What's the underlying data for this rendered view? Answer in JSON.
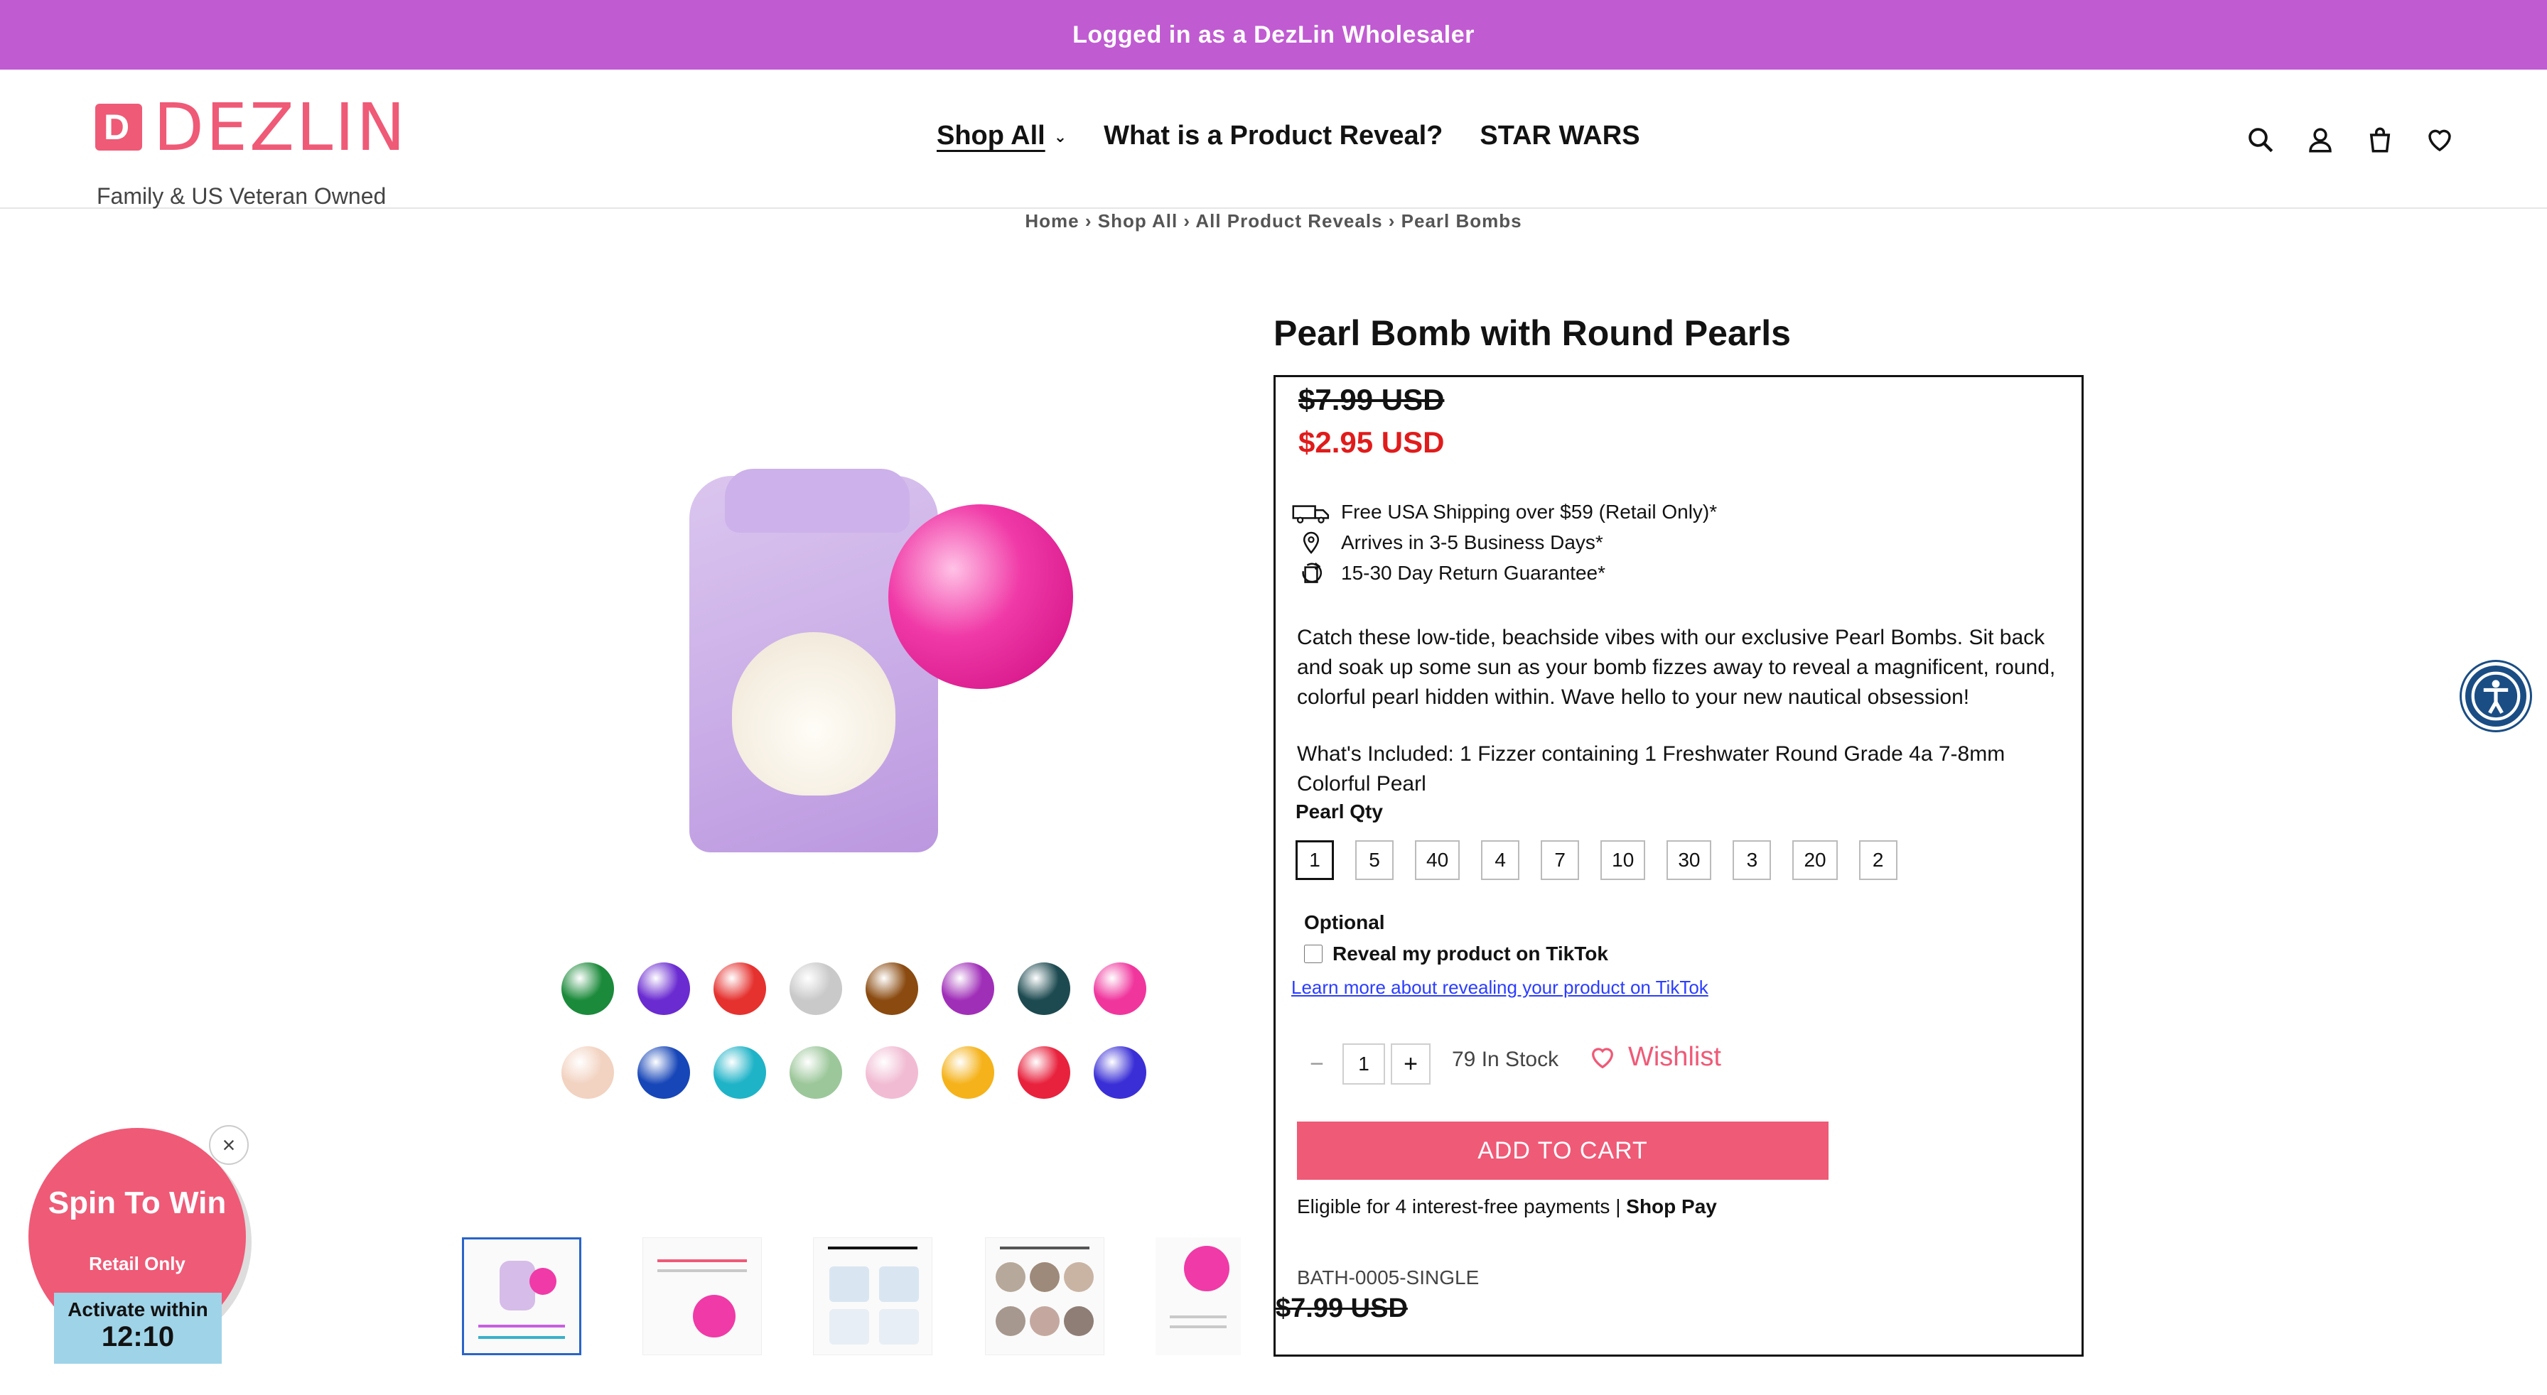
{
  "announcement": "Logged in as a DezLin Wholesaler",
  "brand": {
    "name": "DEZLIN",
    "mark_letter": "D",
    "tagline": "Family & US Veteran Owned",
    "accent_color": "#ef5a77"
  },
  "nav": {
    "items": [
      "Shop All",
      "What is a Product Reveal?",
      "STAR WARS"
    ]
  },
  "header_icons": [
    "search-icon",
    "account-icon",
    "cart-icon",
    "heart-icon"
  ],
  "breadcrumb": "Home › Shop All › All Product Reveals › Pearl Bombs",
  "product": {
    "title": "Pearl Bomb with Round Pearls",
    "price_original": "$7.99 USD",
    "price_sale": "$2.95 USD",
    "benefits": [
      {
        "icon": "truck-icon",
        "text": "Free USA Shipping over $59 (Retail Only)*"
      },
      {
        "icon": "location-pin-icon",
        "text": "Arrives in 3-5 Business Days*"
      },
      {
        "icon": "return-icon",
        "text": "15-30 Day Return Guarantee*"
      }
    ],
    "description": "Catch these low-tide, beachside vibes with our exclusive Pearl Bombs. Sit back and soak up some sun as your bomb fizzes away to reveal a magnificent, round, colorful pearl hidden within. Wave hello to your new nautical obsession!",
    "included": "What's Included: 1 Fizzer containing 1 Freshwater Round Grade 4a 7-8mm Colorful Pearl",
    "qty_label": "Pearl Qty",
    "qty_options": [
      "1",
      "5",
      "40",
      "4",
      "7",
      "10",
      "30",
      "3",
      "20",
      "2"
    ],
    "qty_selected": "1",
    "optional_label": "Optional",
    "tiktok_label": "Reveal my product on TikTok",
    "learn_more": "Learn more about revealing your product on TikTok",
    "quantity": "1",
    "stock": "79 In Stock",
    "wishlist": "Wishlist",
    "add_to_cart": "ADD TO CART",
    "installments": "Eligible for 4 interest-free payments |",
    "shop_pay": "Shop Pay",
    "sku": "BATH-0005-SINGLE",
    "price_repeat": "$7.99 USD"
  },
  "swatch_colors": [
    "#1b8a3a",
    "#6a2bd1",
    "#e5322f",
    "#c9c9c9",
    "#8a4a10",
    "#a02fb8",
    "#1c4a50",
    "#f0369d",
    "#f2d2c0",
    "#1746b8",
    "#1fb3c7",
    "#9cc79a",
    "#f1bcd3",
    "#f5b21a",
    "#e8223d",
    "#3a2fd6"
  ],
  "thumbnails": [
    {
      "label": ""
    },
    {
      "label": "Pearl Bomb with Colorful Round Pearl"
    },
    {
      "label": "How to Reveal"
    },
    {
      "label": "Great for all types of occasions!"
    },
    {
      "label": "Handcrafted in the USA by a Family & Veteran Owned Company"
    }
  ],
  "popup": {
    "title": "Spin To Win",
    "subtitle": "Retail Only",
    "timer_label": "Activate within",
    "timer_value": "12:10"
  }
}
